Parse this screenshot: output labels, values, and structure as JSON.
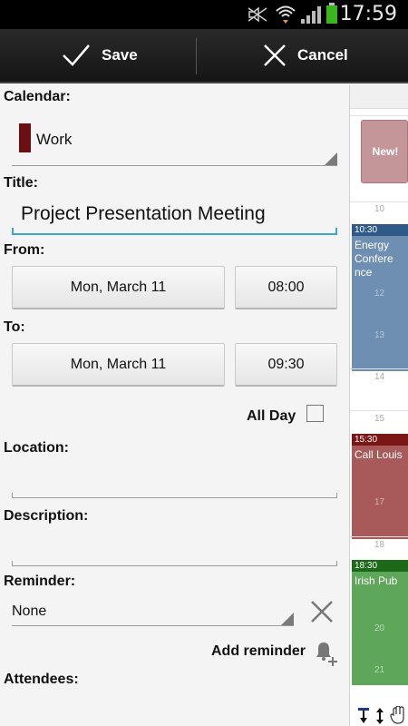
{
  "status": {
    "time": "17:59"
  },
  "actionbar": {
    "save_label": "Save",
    "cancel_label": "Cancel"
  },
  "form": {
    "calendar_label": "Calendar:",
    "calendar_value": "Work",
    "calendar_color": "#6b0f12",
    "title_label": "Title:",
    "title_value": "Project Presentation Meeting",
    "from_label": "From:",
    "from_date": "Mon, March 11",
    "from_time": "08:00",
    "to_label": "To:",
    "to_date": "Mon, March 11",
    "to_time": "09:30",
    "allday_label": "All Day",
    "location_label": "Location:",
    "description_label": "Description:",
    "reminder_label": "Reminder:",
    "reminder_value": "None",
    "add_reminder_label": "Add reminder",
    "attendees_label": "Attendees:"
  },
  "day_panel": {
    "new_event_label": "New!",
    "hours": [
      "10",
      "12",
      "13",
      "14",
      "15",
      "17",
      "18",
      "20",
      "21"
    ],
    "events": [
      {
        "time": "10:30",
        "name": "Energy Conference",
        "header_color": "#2f5a88",
        "body_color": "#6e8eb2"
      },
      {
        "time": "15:30",
        "name": "Call Louis",
        "header_color": "#7a1616",
        "body_color": "#a85959"
      },
      {
        "time": "18:30",
        "name": "Irish Pub",
        "header_color": "#1c6a19",
        "body_color": "#5ea65a"
      }
    ]
  }
}
